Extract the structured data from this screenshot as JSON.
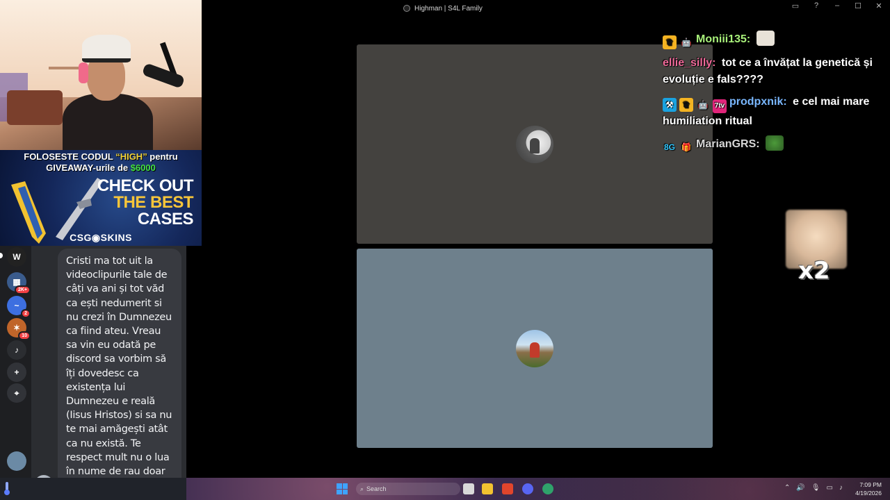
{
  "window": {
    "title": "Highman | S4L Family"
  },
  "banner": {
    "promo_pre": "FOLOSESTE CODUL ",
    "promo_code": "“HIGH”",
    "promo_post": " pentru",
    "promo_line2_pre": "GIVEAWAY-urile de ",
    "promo_amount": "$6000",
    "cta_line1": "CHECK OUT",
    "cta_line2": "THE BEST",
    "cta_line3": "CASES",
    "logo": "CSG◉SKINS",
    "colors": {
      "code": "#f2d33a",
      "amount": "#45e046",
      "highlight": "#f7c53a"
    }
  },
  "server_rail": {
    "items": [
      {
        "icon": "w-server-icon",
        "label": "W",
        "color": "#222"
      },
      {
        "icon": "server-folder-icon",
        "badge": "2K+",
        "color": "#3a5b8c"
      },
      {
        "icon": "server-blue-icon",
        "badge": "2",
        "color": "#3d6fe0"
      },
      {
        "icon": "server-fire-icon",
        "badge": "10",
        "color": "#c0652a"
      },
      {
        "icon": "server-music-icon",
        "label": "♪",
        "color": "#2b2d31"
      },
      {
        "icon": "add-server-icon",
        "label": "+",
        "color": "#313338"
      },
      {
        "icon": "explore-icon",
        "label": "⌖",
        "color": "#313338"
      }
    ]
  },
  "message": {
    "text": "Cristi ma tot uit la videoclipurile tale de câți va ani și tot văd ca ești nedumerit si nu crezi în Dumnezeu ca fiind ateu. Vreau sa vin eu odată pe discord sa vorbim să îți dovedesc ca existența lui Dumnezeu e reală (Iisus Hristos) si sa nu te mai amăgești atât ca nu există. Te respect mult nu o lua în nume de rau doar vreau să-ți dovedesc ca te înșeli. Love you 🫶"
  },
  "overlay_chat": {
    "lines": [
      {
        "user": "Moniii135:",
        "user_color": "#a8f07a",
        "badges": [
          "crown-badge",
          "robot-badge"
        ],
        "text": "",
        "emote": "cat-emote"
      },
      {
        "user": "ellie_silly:",
        "user_color": "#f06a9a",
        "badges": [],
        "text": "tot ce a învățat la genetică și evoluție e fals????"
      },
      {
        "user": "prodpxnik:",
        "user_color": "#7ab8ff",
        "badges": [
          "hammer-badge",
          "crown-badge",
          "robot-badge",
          "7tv-badge"
        ],
        "text": "e cel mai mare humiliation ritual"
      },
      {
        "user": "MarianGRS:",
        "user_color": "#d7d7d7",
        "badges": [
          "tag-badge",
          "gift-badge"
        ],
        "text": "",
        "emote": "pepe-emote"
      }
    ]
  },
  "combo": {
    "count": "x2"
  },
  "taskbar": {
    "search_placeholder": "Search",
    "time": "7:09 PM",
    "date": "4/19/2026"
  }
}
